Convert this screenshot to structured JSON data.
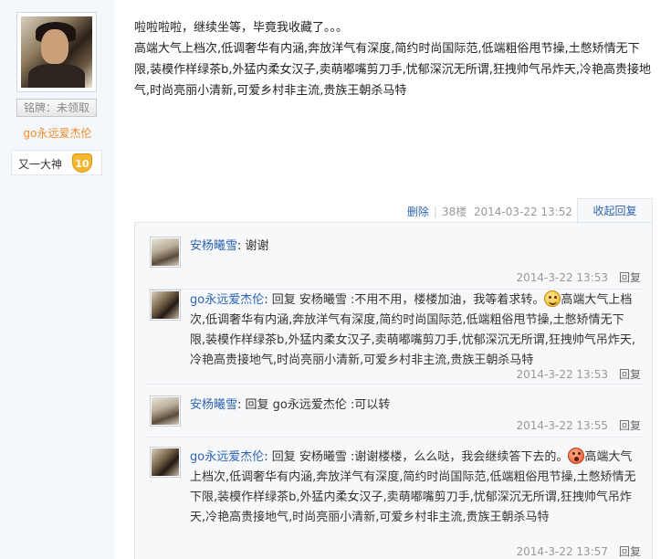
{
  "author": {
    "badge": "铭牌：未领取",
    "name": "go永远爱杰伦",
    "level_title": "又一大神",
    "level_number": "10"
  },
  "post": {
    "line1": "啦啦啦啦，继续坐等，毕竟我收藏了。。。",
    "line2": "高端大气上档次,低调奢华有内涵,奔放洋气有深度,简约时尚国际范,低端粗俗甩节操,土憋矫情无下限,装模作样绿茶b,外猛内柔女汉子,卖萌嘟嘴剪刀手,忧郁深沉无所谓,狂拽帅气吊炸天,冷艳高贵接地气,时尚亮丽小清新,可爱乡村非主流,贵族王朝杀马特"
  },
  "tail": {
    "delete": "删除",
    "floor": "38楼",
    "time": "2014-03-22 13:52",
    "fold": "收起回复"
  },
  "replies": [
    {
      "user": "安杨曦雪",
      "text": ": 谢谢",
      "time": "2014-3-22 13:53",
      "reply_label": "回复",
      "avatar": "girl"
    },
    {
      "user": "go永远爱杰伦",
      "text": ": 回复 安杨曦雪 :不用不用，楼楼加油，我等着求转。",
      "emoji": "smile",
      "tail": "高端大气上档次,低调奢华有内涵,奔放洋气有深度,简约时尚国际范,低端粗俗甩节操,土憋矫情无下限,装模作样绿茶b,外猛内柔女汉子,卖萌嘟嘴剪刀手,忧郁深沉无所谓,狂拽帅气吊炸天,冷艳高贵接地气,时尚亮丽小清新,可爱乡村非主流,贵族王朝杀马特",
      "time": "2014-3-22 13:53",
      "reply_label": "回复",
      "avatar": "boy"
    },
    {
      "user": "安杨曦雪",
      "text": ": 回复 go永远爱杰伦 :可以转",
      "time": "2014-3-22 13:55",
      "reply_label": "回复",
      "avatar": "girl"
    },
    {
      "user": "go永远爱杰伦",
      "text": ": 回复 安杨曦雪 :谢谢楼楼，么么哒，我会继续答下去的。",
      "emoji": "wow",
      "tail": "高端大气上档次,低调奢华有内涵,奔放洋气有深度,简约时尚国际范,低端粗俗甩节操,土憋矫情无下限,装模作样绿茶b,外猛内柔女汉子,卖萌嘟嘴剪刀手,忧郁深沉无所谓,狂拽帅气吊炸天,冷艳高贵接地气,时尚亮丽小清新,可爱乡村非主流,贵族王朝杀马特",
      "time": "2014-3-22 13:57",
      "reply_label": "回复",
      "avatar": "boy"
    }
  ]
}
